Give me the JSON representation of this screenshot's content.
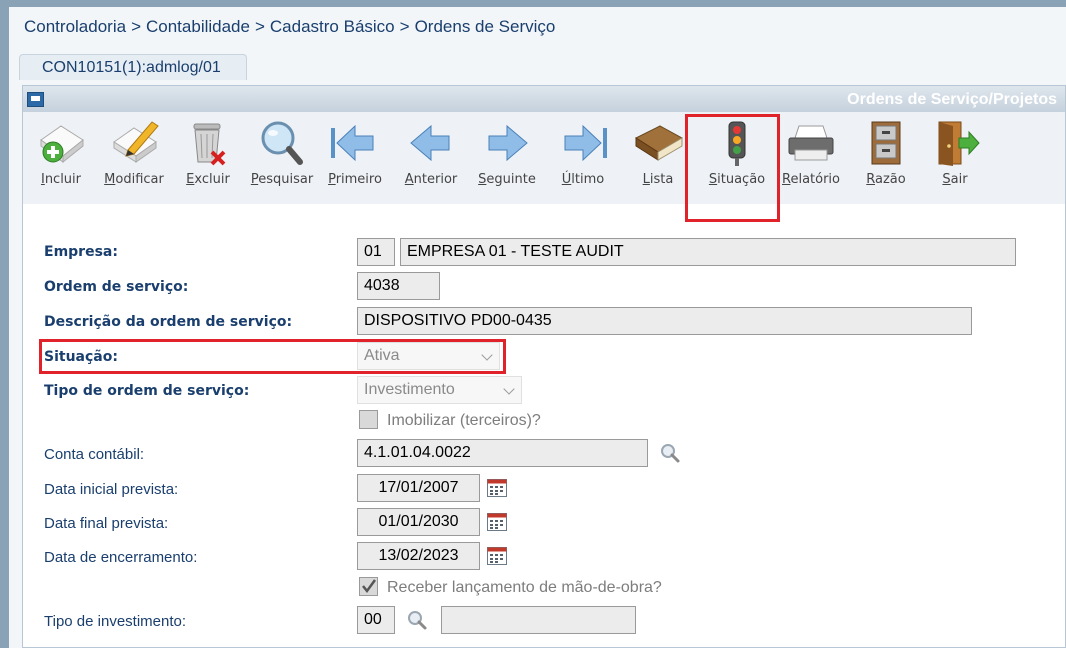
{
  "breadcrumb": [
    "Controladoria",
    "Contabilidade",
    "Cadastro Básico",
    "Ordens de Serviço"
  ],
  "breadcrumb_sep": ">",
  "tab": {
    "label": "CON10151(1):admlog/01"
  },
  "window": {
    "title": "Ordens de Serviço/Projetos"
  },
  "toolbar": [
    {
      "key": "incluir",
      "first": "I",
      "rest": "ncluir"
    },
    {
      "key": "modificar",
      "first": "M",
      "rest": "odificar"
    },
    {
      "key": "excluir",
      "first": "E",
      "rest": "xcluir"
    },
    {
      "key": "pesquisar",
      "first": "P",
      "rest": "esquisar"
    },
    {
      "key": "primeiro",
      "first": "P",
      "rest": "rimeiro"
    },
    {
      "key": "anterior",
      "first": "A",
      "rest": "nterior"
    },
    {
      "key": "seguinte",
      "first": "S",
      "rest": "eguinte"
    },
    {
      "key": "ultimo",
      "first": "Ú",
      "rest": "ltimo"
    },
    {
      "key": "lista",
      "first": "L",
      "rest": "ista"
    },
    {
      "key": "situacao",
      "first": "S",
      "rest": "ituação"
    },
    {
      "key": "relatorio",
      "first": "R",
      "rest": "elatório"
    },
    {
      "key": "razao",
      "first": "R",
      "rest": "azão"
    },
    {
      "key": "sair",
      "first": "S",
      "rest": "air"
    }
  ],
  "form": {
    "empresa": {
      "label": "Empresa:",
      "code": "01",
      "name": "EMPRESA 01 - TESTE AUDIT"
    },
    "ordem": {
      "label": "Ordem de serviço:",
      "value": "4038"
    },
    "descricao": {
      "label": "Descrição da ordem de serviço:",
      "value": "DISPOSITIVO PD00-0435"
    },
    "situacao": {
      "label": "Situação:",
      "value": "Ativa"
    },
    "tipo_ordem": {
      "label": "Tipo de ordem de serviço:",
      "value": "Investimento"
    },
    "imobilizar": {
      "label": "Imobilizar (terceiros)?",
      "checked": false
    },
    "conta": {
      "label": "Conta contábil:",
      "value": "4.1.01.04.0022"
    },
    "data_inicial": {
      "label": "Data inicial prevista:",
      "value": "17/01/2007"
    },
    "data_final": {
      "label": "Data final prevista:",
      "value": "01/01/2030"
    },
    "data_encerramento": {
      "label": "Data de encerramento:",
      "value": "13/02/2023"
    },
    "receber": {
      "label": "Receber lançamento de mão-de-obra?",
      "checked": true
    },
    "tipo_investimento": {
      "label": "Tipo de investimento:",
      "code": "00",
      "name": ""
    }
  },
  "colors": {
    "label_blue": "#1a3f6e",
    "highlight_red": "#e0232b",
    "titlebar_text": "#ffffff"
  }
}
